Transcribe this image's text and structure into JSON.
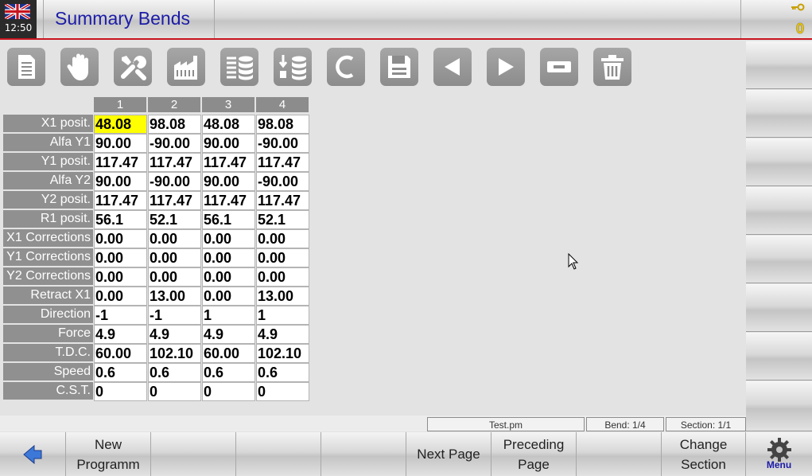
{
  "header": {
    "clock": "12:50",
    "title": "Summary Bends",
    "key_count": "0"
  },
  "toolbar": {
    "icons": [
      "document-icon",
      "hand-icon",
      "wrench-icon",
      "factory-icon",
      "database-list-icon",
      "database-sort-icon",
      "c-icon",
      "save-icon",
      "previous-icon",
      "next-icon",
      "minus-icon",
      "trash-icon"
    ]
  },
  "table": {
    "columns": [
      "1",
      "2",
      "3",
      "4"
    ],
    "rows": [
      {
        "label": "X1 posit.",
        "values": [
          "48.08",
          "98.08",
          "48.08",
          "98.08"
        ]
      },
      {
        "label": "Alfa Y1",
        "values": [
          "90.00",
          "-90.00",
          "90.00",
          "-90.00"
        ]
      },
      {
        "label": "Y1 posit.",
        "values": [
          "117.47",
          "117.47",
          "117.47",
          "117.47"
        ]
      },
      {
        "label": "Alfa Y2",
        "values": [
          "90.00",
          "-90.00",
          "90.00",
          "-90.00"
        ]
      },
      {
        "label": "Y2 posit.",
        "values": [
          "117.47",
          "117.47",
          "117.47",
          "117.47"
        ]
      },
      {
        "label": "R1 posit.",
        "values": [
          "56.1",
          "52.1",
          "56.1",
          "52.1"
        ]
      },
      {
        "label": "X1 Corrections",
        "values": [
          "0.00",
          "0.00",
          "0.00",
          "0.00"
        ]
      },
      {
        "label": "Y1 Corrections",
        "values": [
          "0.00",
          "0.00",
          "0.00",
          "0.00"
        ]
      },
      {
        "label": "Y2 Corrections",
        "values": [
          "0.00",
          "0.00",
          "0.00",
          "0.00"
        ]
      },
      {
        "label": "Retract X1",
        "values": [
          "0.00",
          "13.00",
          "0.00",
          "13.00"
        ]
      },
      {
        "label": "Direction",
        "values": [
          "-1",
          "-1",
          "1",
          "1"
        ]
      },
      {
        "label": "Force",
        "values": [
          "4.9",
          "4.9",
          "4.9",
          "4.9"
        ]
      },
      {
        "label": "T.D.C.",
        "values": [
          "60.00",
          "102.10",
          "60.00",
          "102.10"
        ]
      },
      {
        "label": "Speed",
        "values": [
          "0.6",
          "0.6",
          "0.6",
          "0.6"
        ]
      },
      {
        "label": "C.S.T.",
        "values": [
          "0",
          "0",
          "0",
          "0"
        ]
      }
    ]
  },
  "status": {
    "file": "Test.pm",
    "bend": "Bend: 1/4",
    "section": "Section: 1/1"
  },
  "footer": {
    "new_programm": "New\nProgramm",
    "next_page": "Next Page",
    "preceding_page": "Preceding\nPage",
    "change_section": "Change\nSection",
    "menu": "Menu"
  },
  "colors": {
    "title": "#1c1ca8",
    "accent_line": "#c8141e",
    "selected_cell": "#ffff00",
    "key_count": "#e8c000"
  }
}
